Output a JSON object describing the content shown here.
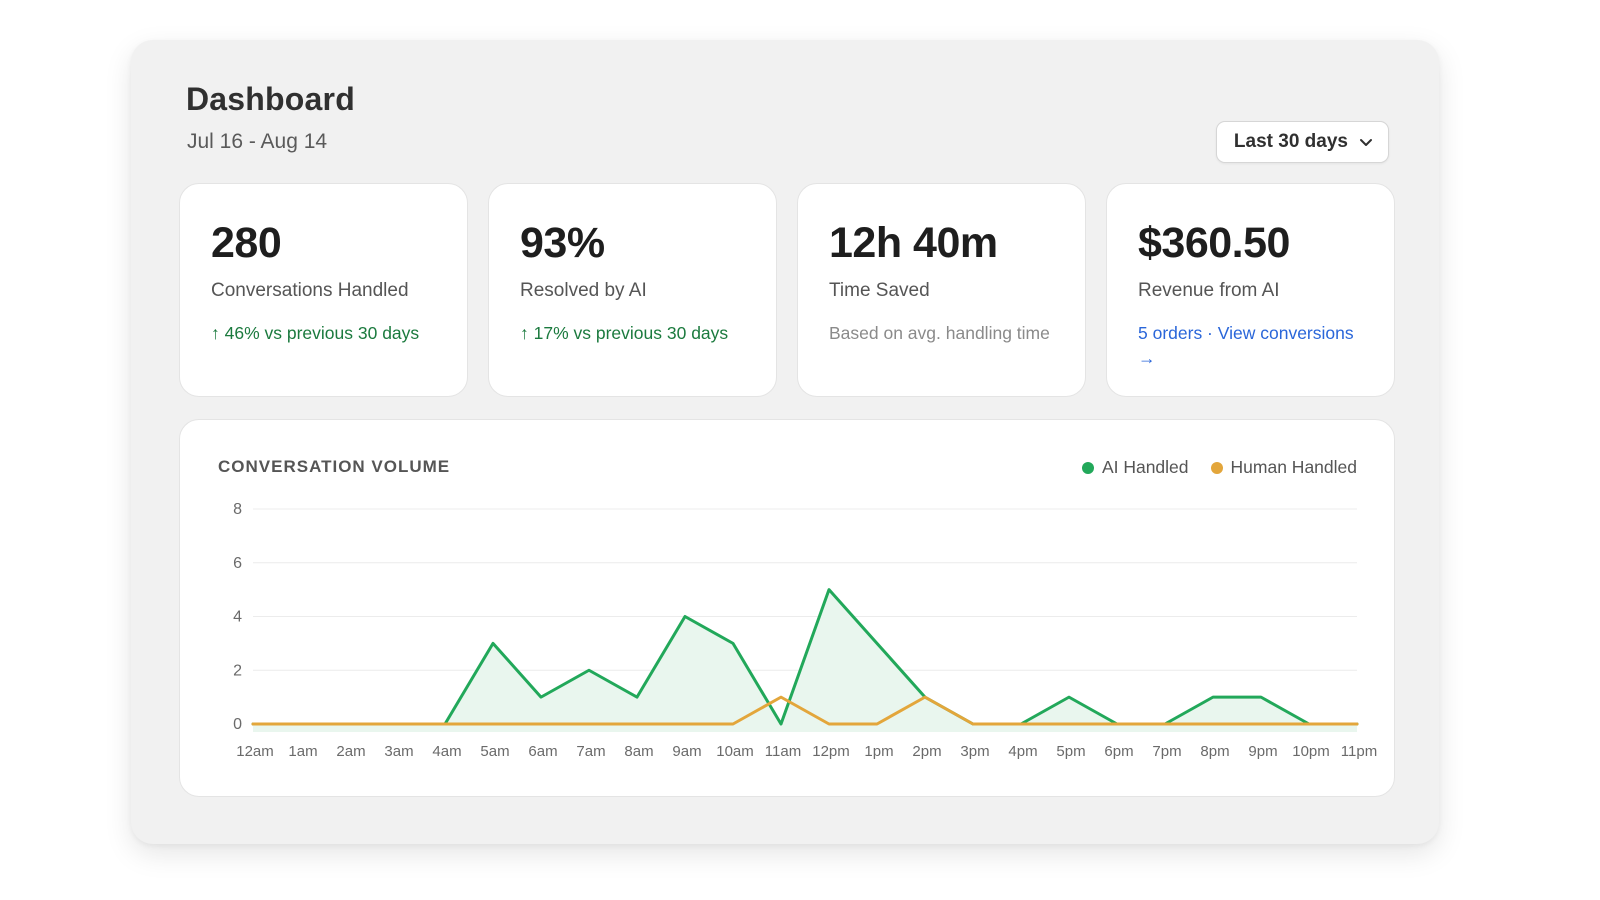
{
  "header": {
    "title": "Dashboard",
    "date_range": "Jul 16 - Aug 14",
    "range_select": {
      "value": "Last 30 days",
      "icon": "chevron-down-icon"
    }
  },
  "stats": [
    {
      "value": "280",
      "label": "Conversations Handled",
      "note": "↑ 46% vs previous 30 days"
    },
    {
      "value": "93%",
      "label": "Resolved by AI",
      "note": "↑ 17% vs previous 30 days"
    },
    {
      "value": "12h 40m",
      "label": "Time Saved",
      "note": "Based on avg. handling time"
    },
    {
      "value": "$360.50",
      "label": "Revenue from AI",
      "note": "5 orders · View conversions →"
    }
  ],
  "colors": {
    "positive": "#1b7a3e",
    "link": "#2a66d9",
    "ai_series": "#22a85a",
    "ai_fill": "#e9f6ee",
    "human_series": "#e3a63b"
  },
  "chart": {
    "title": "CONVERSATION VOLUME",
    "legend": [
      "AI Handled",
      "Human Handled"
    ]
  },
  "chart_data": {
    "type": "line",
    "title": "CONVERSATION VOLUME",
    "categories": [
      "12am",
      "1am",
      "2am",
      "3am",
      "4am",
      "5am",
      "6am",
      "7am",
      "8am",
      "9am",
      "10am",
      "11am",
      "12pm",
      "1pm",
      "2pm",
      "3pm",
      "4pm",
      "5pm",
      "6pm",
      "7pm",
      "8pm",
      "9pm",
      "10pm",
      "11pm"
    ],
    "series": [
      {
        "name": "AI Handled",
        "values": [
          0,
          0,
          0,
          0,
          0,
          3,
          1,
          2,
          1,
          4,
          3,
          0,
          5,
          3,
          1,
          0,
          0,
          1,
          0,
          0,
          1,
          1,
          0,
          0
        ]
      },
      {
        "name": "Human Handled",
        "values": [
          0,
          0,
          0,
          0,
          0,
          0,
          0,
          0,
          0,
          0,
          0,
          1,
          0,
          0,
          1,
          0,
          0,
          0,
          0,
          0,
          0,
          0,
          0,
          0
        ]
      }
    ],
    "yticks": [
      0,
      2,
      4,
      6,
      8
    ],
    "ylim": [
      0,
      8
    ],
    "grid": true,
    "legend_position": "top-right",
    "area_fill": "AI Handled"
  }
}
